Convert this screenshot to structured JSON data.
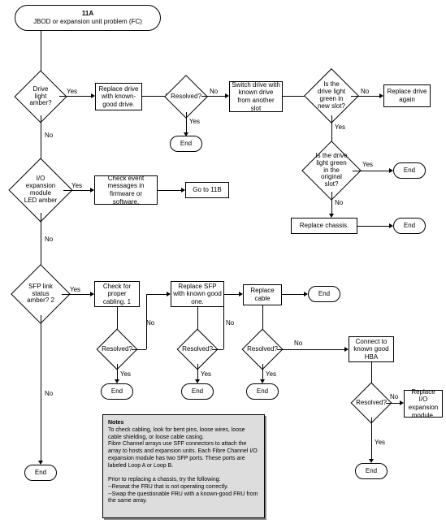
{
  "chart_data": {
    "type": "table",
    "title": "11A JBOD or expansion unit problem (FC)",
    "nodes": [
      {
        "id": "start",
        "type": "terminator",
        "label": "11A\nJBOD or expansion unit problem (FC)"
      },
      {
        "id": "d_drive",
        "type": "decision",
        "label": "Drive light amber?"
      },
      {
        "id": "p_replace_drive",
        "type": "process",
        "label": "Replace drive with known-good drive."
      },
      {
        "id": "d_res1",
        "type": "decision",
        "label": "Resolved?"
      },
      {
        "id": "end1",
        "type": "terminator",
        "label": "End"
      },
      {
        "id": "p_switch",
        "type": "process",
        "label": "Switch drive with known drive from another slot"
      },
      {
        "id": "d_green_new",
        "type": "decision",
        "label": "Is the drive light green in new slot?"
      },
      {
        "id": "p_replace_again",
        "type": "process",
        "label": "Replace drive again"
      },
      {
        "id": "d_green_orig",
        "type": "decision",
        "label": "Is the drive light green in the original slot?"
      },
      {
        "id": "end2",
        "type": "terminator",
        "label": "End"
      },
      {
        "id": "p_replace_chassis",
        "type": "process",
        "label": "Replace chassis."
      },
      {
        "id": "end3",
        "type": "terminator",
        "label": "End"
      },
      {
        "id": "d_ioexp",
        "type": "decision",
        "label": "I/O expansion module LED amber"
      },
      {
        "id": "p_checkevent",
        "type": "process",
        "label": "Check event messages in firmware or software."
      },
      {
        "id": "p_goto11b",
        "type": "process",
        "label": "Go to 11B"
      },
      {
        "id": "d_sfp",
        "type": "decision",
        "label": "SFP link status amber? 2"
      },
      {
        "id": "p_checkcable",
        "type": "process",
        "label": "Check for proper cabling. 1"
      },
      {
        "id": "d_res_c1",
        "type": "decision",
        "label": "Resolved?"
      },
      {
        "id": "end_c1",
        "type": "terminator",
        "label": "End"
      },
      {
        "id": "p_replace_sfp",
        "type": "process",
        "label": "Replace SFP with known good one."
      },
      {
        "id": "d_res_c2",
        "type": "decision",
        "label": "Resolved?"
      },
      {
        "id": "end_c2",
        "type": "terminator",
        "label": "End"
      },
      {
        "id": "p_replace_cable",
        "type": "process",
        "label": "Replace cable"
      },
      {
        "id": "d_res_c3",
        "type": "decision",
        "label": "Resolved?"
      },
      {
        "id": "end_c3",
        "type": "terminator",
        "label": "End"
      },
      {
        "id": "end_c_top",
        "type": "terminator",
        "label": "End"
      },
      {
        "id": "p_connect_hba",
        "type": "process",
        "label": "Connect to known good HBA"
      },
      {
        "id": "d_res_c4",
        "type": "decision",
        "label": "Resolved?"
      },
      {
        "id": "end_c4",
        "type": "terminator",
        "label": "End"
      },
      {
        "id": "p_replace_iomod",
        "type": "process",
        "label": "Replace I/O expansion module."
      },
      {
        "id": "end_left",
        "type": "terminator",
        "label": "End"
      }
    ],
    "edges": [
      {
        "from": "start",
        "to": "d_drive"
      },
      {
        "from": "d_drive",
        "to": "p_replace_drive",
        "label": "Yes"
      },
      {
        "from": "d_drive",
        "to": "d_ioexp",
        "label": "No"
      },
      {
        "from": "p_replace_drive",
        "to": "d_res1"
      },
      {
        "from": "d_res1",
        "to": "end1",
        "label": "Yes"
      },
      {
        "from": "d_res1",
        "to": "p_switch",
        "label": "No"
      },
      {
        "from": "p_switch",
        "to": "d_green_new"
      },
      {
        "from": "d_green_new",
        "to": "p_replace_again",
        "label": "No"
      },
      {
        "from": "d_green_new",
        "to": "d_green_orig",
        "label": "Yes"
      },
      {
        "from": "d_green_orig",
        "to": "end2",
        "label": "Yes"
      },
      {
        "from": "d_green_orig",
        "to": "p_replace_chassis",
        "label": "No"
      },
      {
        "from": "p_replace_chassis",
        "to": "end3"
      },
      {
        "from": "d_ioexp",
        "to": "p_checkevent",
        "label": "Yes"
      },
      {
        "from": "d_ioexp",
        "to": "d_sfp",
        "label": "No"
      },
      {
        "from": "p_checkevent",
        "to": "p_goto11b"
      },
      {
        "from": "d_sfp",
        "to": "p_checkcable",
        "label": "Yes"
      },
      {
        "from": "d_sfp",
        "to": "end_left",
        "label": "No"
      },
      {
        "from": "p_checkcable",
        "to": "d_res_c1"
      },
      {
        "from": "d_res_c1",
        "to": "end_c1",
        "label": "Yes"
      },
      {
        "from": "d_res_c1",
        "to": "p_replace_sfp",
        "label": "No"
      },
      {
        "from": "p_replace_sfp",
        "to": "d_res_c2"
      },
      {
        "from": "d_res_c2",
        "to": "end_c2",
        "label": "Yes"
      },
      {
        "from": "d_res_c2",
        "to": "p_replace_cable",
        "label": "No"
      },
      {
        "from": "p_replace_cable",
        "to": "d_res_c3"
      },
      {
        "from": "p_replace_cable",
        "to": "end_c_top"
      },
      {
        "from": "d_res_c3",
        "to": "end_c3",
        "label": "Yes"
      },
      {
        "from": "d_res_c3",
        "to": "p_connect_hba",
        "label": "No"
      },
      {
        "from": "p_connect_hba",
        "to": "d_res_c4"
      },
      {
        "from": "d_res_c4",
        "to": "end_c4",
        "label": "Yes"
      },
      {
        "from": "d_res_c4",
        "to": "p_replace_iomod",
        "label": "No"
      }
    ]
  },
  "labels": {
    "yes": "Yes",
    "no": "No"
  },
  "start": {
    "line1": "11A",
    "line2": "JBOD or expansion unit problem (FC)"
  },
  "nodes": {
    "d_drive": "Drive light amber?",
    "p_replace_drive": "Replace drive with known-good drive.",
    "d_res1": "Resolved?",
    "end1": "End",
    "p_switch": "Switch drive with known drive from another slot",
    "d_green_new": "Is the drive light green in new slot?",
    "p_replace_again": "Replace drive again",
    "d_green_orig": "Is the drive light green in the original slot?",
    "end2": "End",
    "p_replace_chassis": "Replace chassis.",
    "end3": "End",
    "d_ioexp": "I/O expansion module LED amber",
    "p_checkevent": "Check event messages in firmware or software.",
    "p_goto11b": "Go to 11B",
    "d_sfp": "SFP link status amber? 2",
    "p_checkcable": "Check for proper cabling. 1",
    "d_res_c1": "Resolved?",
    "end_c1": "End",
    "p_replace_sfp": "Replace SFP with known good one.",
    "d_res_c2": "Resolved?",
    "end_c2": "End",
    "p_replace_cable": "Replace cable",
    "d_res_c3": "Resolved?",
    "end_c3": "End",
    "end_c_top": "End",
    "p_connect_hba": "Connect to known good HBA",
    "d_res_c4": "Resolved?",
    "end_c4": "End",
    "p_replace_iomod": "Replace I/O expansion module.",
    "end_left": "End"
  },
  "notes": {
    "title": "Notes",
    "p1": "To check cabling, look for bent pins, loose wires, loose cable shielding, or loose cable casing.",
    "p2": "Fibre Channel arrays use SFF connectors to attach the array to hosts and expansion units. Each Fibre Channel I/O expansion module has two SFP ports. These ports are labeled Loop A or Loop B.",
    "p3": "Prior to replacing a chassis, try the following:",
    "b1": "--Reseat the FRU that is not operating correctly.",
    "b2": "--Swap the questionable FRU with a known-good FRU from the same array."
  }
}
